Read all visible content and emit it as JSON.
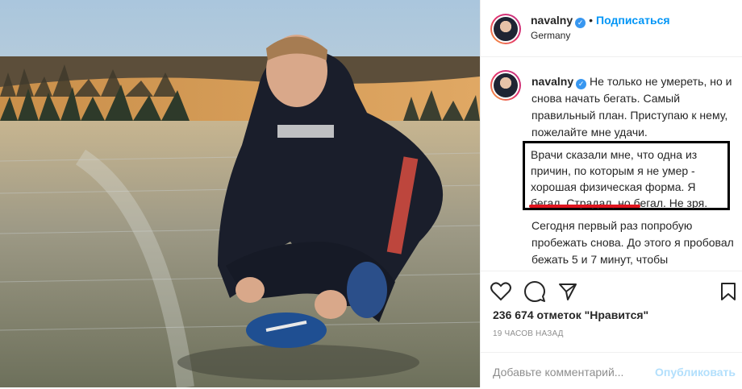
{
  "post": {
    "username": "navalny",
    "follow_label": "Подписаться",
    "location": "Germany",
    "caption_text": "Не только не умереть, но и снова начать бегать. Самый правильный план. Приступаю к нему, пожелайте мне удачи.",
    "highlight_line1": "Врачи сказали мне, что одна из причин, по которым я не умер - хорошая физическая форма. Я бегал.",
    "highlight_line2": "Страдал, но бегал. Не зря.",
    "paragraph2": "Сегодня первый раз попробую пробежать снова. До этого я пробовал бежать 5 и 7 минут, чтобы",
    "likes": "236 674 отметок \"Нравится\"",
    "time_ago": "19 ЧАСОВ НАЗАД",
    "comment_placeholder": "Добавьте комментарий...",
    "publish_label": "Опубликовать"
  },
  "colors": {
    "accent": "#0095f6",
    "highlight_underline": "#e0141e",
    "text": "#262626",
    "muted": "#8e8e8e"
  }
}
